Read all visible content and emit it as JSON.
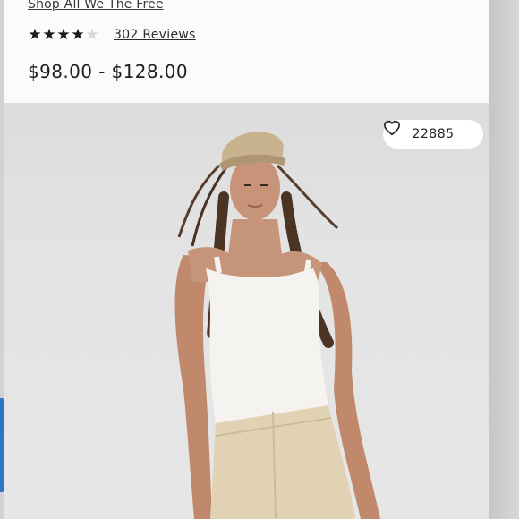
{
  "product": {
    "shop_link": "Shop All We The Free",
    "rating": {
      "value": 4,
      "max": 5
    },
    "reviews_label": "302 Reviews",
    "price_range": "$98.00 - $128.00"
  },
  "gallery": {
    "favorites_count": "22885",
    "favorite_icon": "heart-outline-icon",
    "image_alt": "Model wearing tan cap, white ribbed tank top and cream jeans"
  },
  "colors": {
    "accent_link": "#2f74c7",
    "text": "#1e1e1e",
    "star_filled": "#1c1c1c",
    "star_empty": "#d9d9d9"
  }
}
